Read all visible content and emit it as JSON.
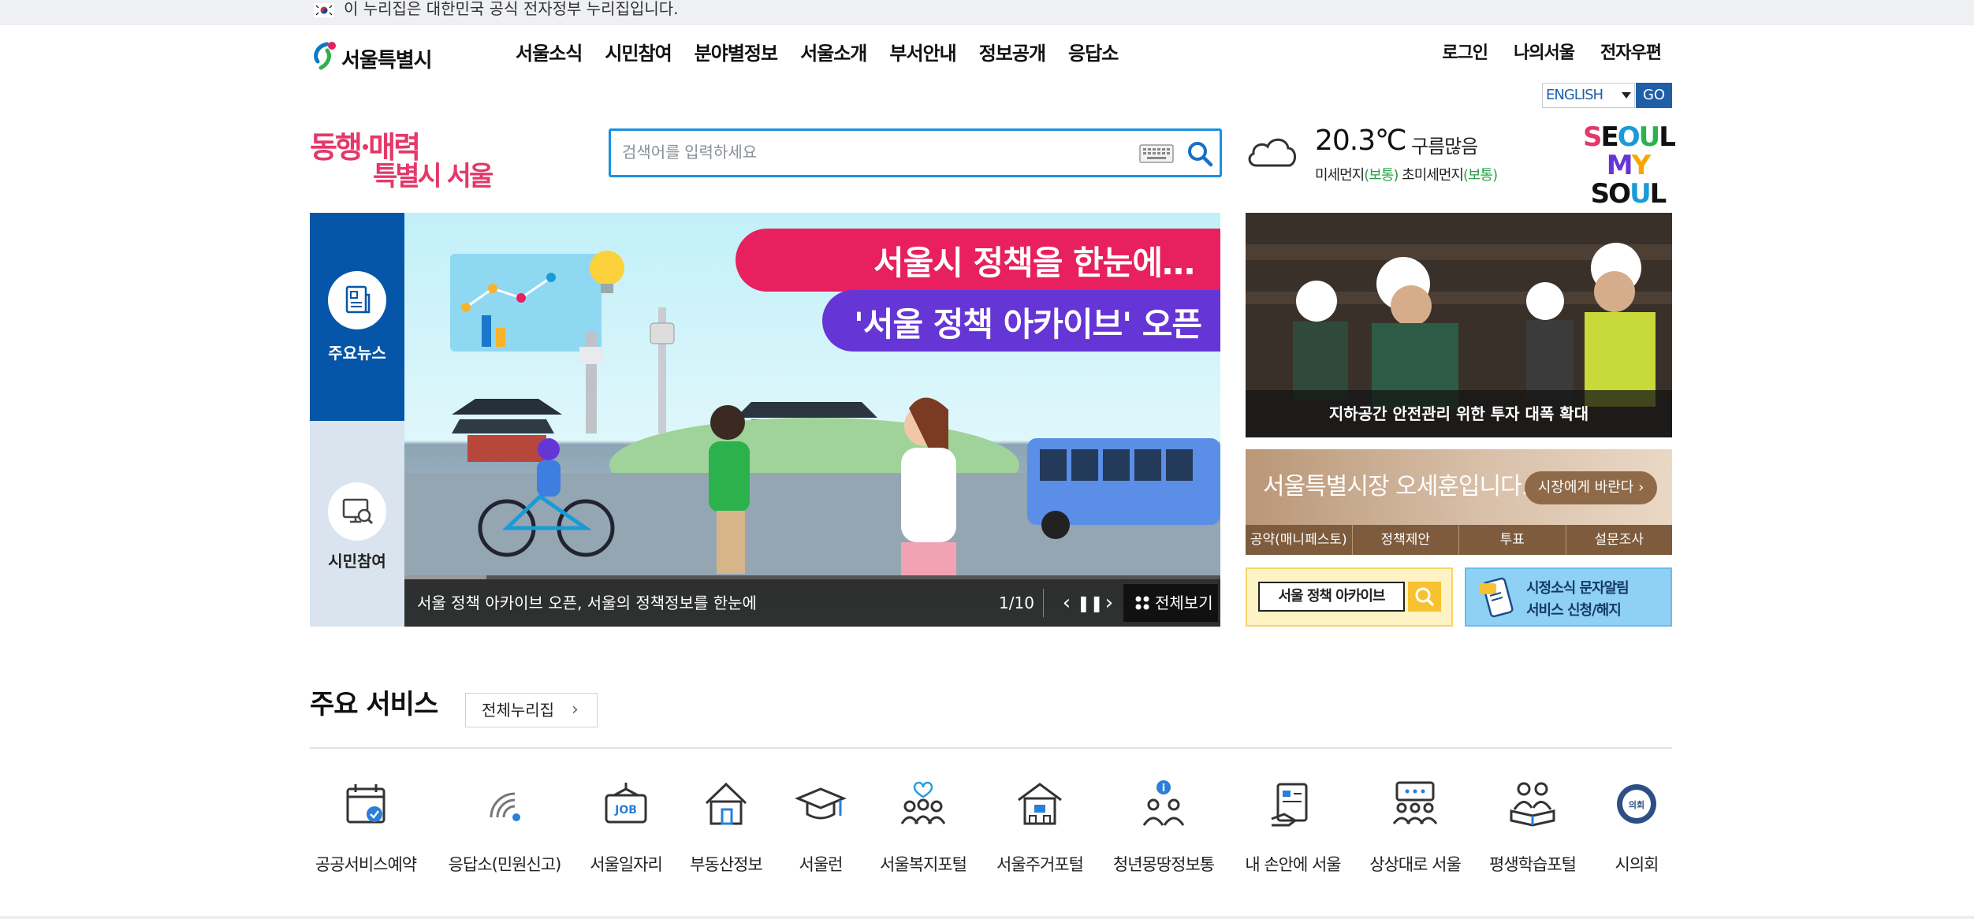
{
  "gov_banner": {
    "text": "이 누리집은 대한민국 공식 전자정부 누리집입니다."
  },
  "header": {
    "logo_text": "서울특별시",
    "gnb": [
      "서울소식",
      "시민참여",
      "분야별정보",
      "서울소개",
      "부서안내",
      "정보공개",
      "응답소"
    ],
    "util": [
      "로그인",
      "나의서울",
      "전자우편"
    ],
    "language": {
      "selected": "ENGLISH",
      "go_label": "GO"
    }
  },
  "slogan": {
    "line1": "동행·매력",
    "line2": "특별시 서울"
  },
  "search": {
    "placeholder": "검색어를 입력하세요",
    "value": ""
  },
  "weather": {
    "temperature": "20.3℃",
    "sky": "구름많음",
    "fine_dust_label": "미세먼지",
    "fine_dust_status": "(보통)",
    "ultrafine_dust_label": "초미세먼지",
    "ultrafine_dust_status": "(보통)"
  },
  "myseoul": {
    "line1": "SEOUL",
    "line2": "MY SOUL"
  },
  "tabs": [
    {
      "label": "주요뉴스",
      "active": true
    },
    {
      "label": "시민참여",
      "active": false
    }
  ],
  "hero": {
    "headline1": "서울시 정책을 한눈에…",
    "headline2": "'서울 정책 아카이브' 오픈",
    "caption": "서울 정책 아카이브 오픈, 서울의 정책정보를 한눈에",
    "page": "1/10",
    "view_all": "전체보기",
    "progress_fraction": 0.1
  },
  "news_photo": {
    "caption": "지하공간 안전관리 위한 투자 대폭 확대"
  },
  "mayor": {
    "title": "서울특별시장 오세훈입니다.",
    "button": "시장에게 바란다 ›",
    "links": [
      "공약(매니페스토)",
      "정책제안",
      "투표",
      "설문조사"
    ]
  },
  "archive_banner": {
    "text": "서울 정책 아카이브"
  },
  "sms_banner": {
    "line1": "시정소식 문자알림",
    "line2": "서비스 신청/해지"
  },
  "services": {
    "title": "주요 서비스",
    "all_button": "전체누리집",
    "items": [
      {
        "label": "공공서비스예약",
        "icon": "calendar-check-icon"
      },
      {
        "label": "응답소(민원신고)",
        "icon": "signal-icon"
      },
      {
        "label": "서울일자리",
        "icon": "job-sign-icon"
      },
      {
        "label": "부동산정보",
        "icon": "house-icon"
      },
      {
        "label": "서울런",
        "icon": "graduation-cap-icon"
      },
      {
        "label": "서울복지포털",
        "icon": "family-heart-icon"
      },
      {
        "label": "서울주거포털",
        "icon": "building-icon"
      },
      {
        "label": "청년몽땅정보통",
        "icon": "youth-info-icon"
      },
      {
        "label": "내 손안에 서울",
        "icon": "tablet-hand-icon"
      },
      {
        "label": "상상대로 서울",
        "icon": "discussion-icon"
      },
      {
        "label": "평생학습포털",
        "icon": "reading-people-icon"
      },
      {
        "label": "시의회",
        "icon": "council-emblem-icon"
      }
    ]
  },
  "colors": {
    "primary_blue": "#0556a8",
    "search_border": "#1d8fe0",
    "pink_slogan": "#e4386a",
    "dust_good": "#2aa04a"
  }
}
